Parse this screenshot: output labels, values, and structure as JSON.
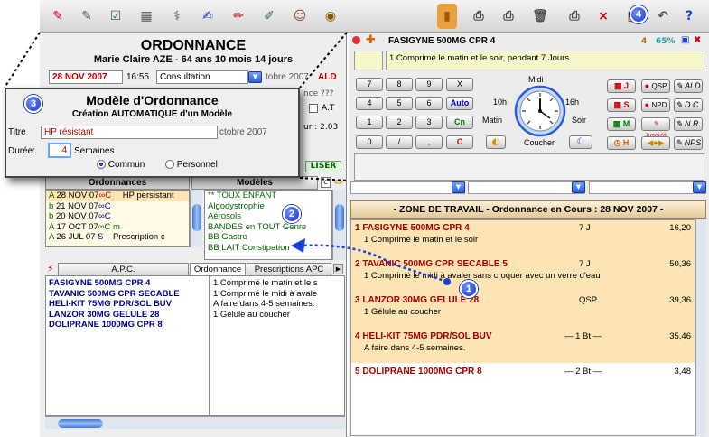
{
  "toolbar": {
    "badge": "4"
  },
  "ordonnance": {
    "title": "ORDONNANCE",
    "patient": "Marie Claire AZE - 64 ans 10 mois 14 jours",
    "date": "28 NOV 2007",
    "time": "16:55",
    "type": "Consultation",
    "date_partial": "tobre 2007",
    "ald": "ALD",
    "hint_partial": "nce ???",
    "at_label": "A.T",
    "value_partial": "ur : 2.03",
    "liser": "LISER"
  },
  "dialog": {
    "badge": "3",
    "title": "Modèle d'Ordonnance",
    "subtitle": "Création AUTOMATIQUE d'un Modèle",
    "titre_label": "Titre",
    "titre_value": "HP résistant",
    "date_partial": "ctobre 2007",
    "duree_label": "Durée:",
    "duree_value": "4",
    "duree_unit": "Semaines",
    "radio_commun": "Commun",
    "radio_personnel": "Personnel"
  },
  "ordonnances_list": {
    "header": "Ordonnances",
    "rows": [
      {
        "letter": "A",
        "date": "28 NOV 07",
        "code": "∞C",
        "label": "HP persistant"
      },
      {
        "letter": "b",
        "date": "21 NOV 07",
        "code": "∞C",
        "label": ""
      },
      {
        "letter": "b",
        "date": "20 NOV 07",
        "code": "∞C",
        "label": ""
      },
      {
        "letter": "A",
        "date": "17 OCT 07",
        "code": "∞C m",
        "label": ""
      },
      {
        "letter": "A",
        "date": "26 JUL 07",
        "code": "S",
        "label": "Prescription c"
      }
    ]
  },
  "modeles_list": {
    "header": "Modèles",
    "badge": "2",
    "rows": [
      "** TOUX ENFANT",
      "Algodystrophie",
      "Aérosols",
      "BANDES en TOUT Genre",
      "BB Gastro",
      "BB LAIT Constipation"
    ]
  },
  "tabs": {
    "apc": "A.P.C.",
    "ordonnance": "Ordonnance",
    "prescriptions": "Prescriptions APC"
  },
  "apc_list": {
    "meds": [
      "FASIGYNE 500MG CPR 4",
      "TAVANIC 500MG CPR SECABLE",
      "HELI-KIT 75MG PDR/SOL BUV",
      "LANZOR 30MG GELULE 28",
      "DOLIPRANE 1000MG CPR 8"
    ],
    "instructions": [
      "1 Comprimé le matin et le s",
      "1 Comprimé le midi  à avale",
      "A faire dans 4-5 semaines.",
      "1 Gélule au coucher"
    ]
  },
  "drug_panel": {
    "name": "FASIGYNE 500MG CPR 4",
    "qty": "4",
    "pct": "65%",
    "instruction": "1 Comprimé le matin et le soir, pendant 7 Jours"
  },
  "keypad": {
    "keys": [
      "7",
      "8",
      "9",
      "X",
      "4",
      "5",
      "6",
      "Auto",
      "1",
      "2",
      "3",
      "Cn",
      "0",
      "/",
      ",",
      "C"
    ],
    "clock": {
      "midi": "Midi",
      "h10": "10h",
      "h16": "16h",
      "matin": "Matin",
      "soir": "Soir",
      "coucher": "Coucher"
    },
    "right_keys": [
      "J",
      "QSP",
      "ALD",
      "S",
      "NPD",
      "D.C.",
      "M",
      "Jusqu'à",
      "N.R.",
      "H",
      "NPS"
    ]
  },
  "zone": {
    "title": "- ZONE DE TRAVAIL - Ordonnance en Cours : 28 NOV 2007 -",
    "badge": "1",
    "items": [
      {
        "name": "1 FASIGYNE 500MG CPR 4",
        "qty": "7 J",
        "price": "16,20",
        "instruction": "1 Comprimé le matin et le soir"
      },
      {
        "name": "2 TAVANIC 500MG CPR SECABLE 5",
        "qty": "7 J",
        "price": "50,36",
        "instruction": "1 Comprimé le midi  à avaler sans croquer avec un verre d'eau"
      },
      {
        "name": "3 LANZOR 30MG GELULE 28",
        "qty": "QSP",
        "price": "39,36",
        "instruction": "1 Gélule au coucher"
      },
      {
        "name": "4 HELI-KIT 75MG PDR/SOL BUV",
        "qty": "— 1 Bt —",
        "price": "35,46",
        "instruction": "A faire dans 4-5 semaines."
      },
      {
        "name": "5 DOLIPRANE 1000MG CPR 8",
        "qty": "— 2 Bt —",
        "price": "3,48",
        "instruction": ""
      }
    ]
  }
}
